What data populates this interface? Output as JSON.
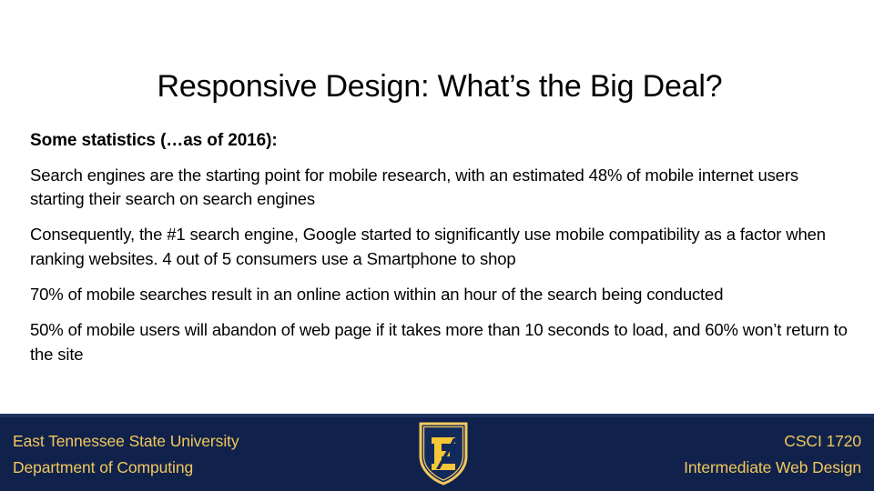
{
  "slide": {
    "title": "Responsive Design: What’s the Big Deal?",
    "background_color": "#ffffff",
    "body": {
      "heading": "Some statistics (…as of 2016):",
      "paragraphs": [
        "Search engines are the starting point for mobile research, with an estimated 48% of mobile internet users starting their search on search engines",
        "Consequently, the #1 search engine, Google started to significantly use mobile compatibility as a factor when ranking websites. 4 out of 5 consumers use a Smartphone to shop",
        "70% of mobile searches result in an online action within an hour of the search being conducted",
        "50% of mobile users will abandon of web page if it takes more than 10 seconds to load, and 60% won’t return to the site"
      ]
    },
    "footer": {
      "background_color": "#10224c",
      "text_color": "#f2c75c",
      "left_line1": "East Tennessee State University",
      "left_line2": "Department of Computing",
      "right_line1": "CSCI 1720",
      "right_line2": "Intermediate Web Design",
      "logo": {
        "name": "etsu-shield-logo",
        "letter": "E",
        "shield_fill": "#12295c",
        "shield_border": "#f2c75c"
      }
    }
  }
}
